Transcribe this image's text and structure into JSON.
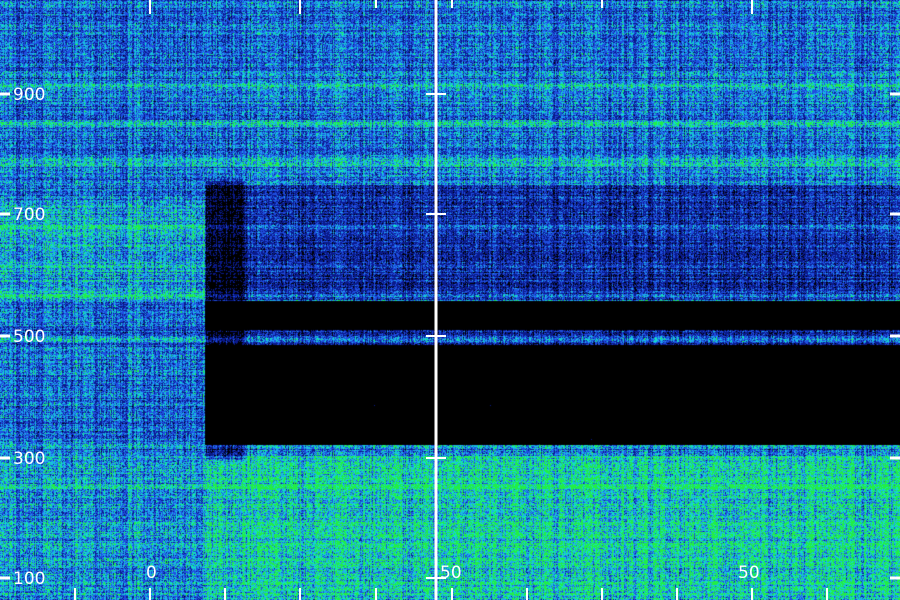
{
  "view": {
    "background": "#000000",
    "divider_color": "#ffffff",
    "tick_color": "#ffffff",
    "label_color": "#ffffff"
  },
  "y_axis": {
    "labels": [
      "900",
      "700",
      "500",
      "300",
      "100"
    ]
  },
  "x_axis": {
    "labels": [
      "0",
      "50",
      "50"
    ]
  },
  "spectrogram": {
    "colormap": [
      "#000000",
      "#0a1a8a",
      "#1f4fe0",
      "#1fa8f0",
      "#12e3c0",
      "#22ee44"
    ],
    "quiet_band_frequencies": [
      500,
      350
    ],
    "onset_label": "0"
  }
}
